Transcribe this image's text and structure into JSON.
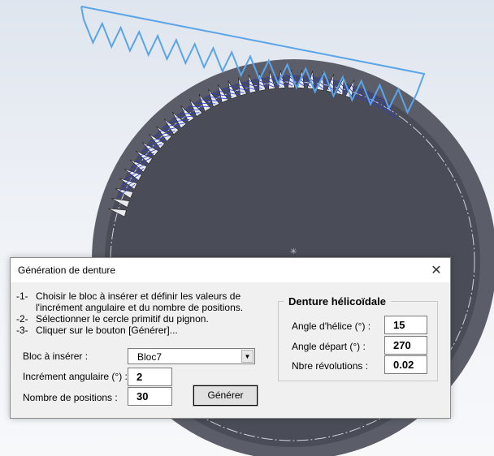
{
  "dialog": {
    "title": "Génération de denture",
    "close_glyph": "✕",
    "instructions": [
      {
        "num": "-1-",
        "text": "Choisir le bloc à insérer et définir les valeurs de"
      },
      {
        "num": "",
        "text": "l'incrément angulaire et du nombre de positions."
      },
      {
        "num": "-2-",
        "text": "Sélectionner le cercle primitif du pignon."
      },
      {
        "num": "-3-",
        "text": "Cliquer sur le bouton [Générer]..."
      }
    ],
    "bloc_label": "Bloc à insérer :",
    "bloc_value": "Bloc7",
    "increment_label": "Incrément angulaire (°) :",
    "increment_value": "2",
    "positions_label": "Nombre de positions :",
    "positions_value": "30",
    "generate_label": "Générer",
    "helical": {
      "title": "Denture hélicoïdale",
      "helix_angle_label": "Angle d'hélice (°) :",
      "helix_angle_value": "15",
      "start_angle_label": "Angle départ (°) :",
      "start_angle_value": "270",
      "revolutions_label": "Nbre révolutions :",
      "revolutions_value": "0.02"
    }
  },
  "colors": {
    "gear_body": "#4a4d57",
    "rack_outline": "#5aa4ea",
    "dialog_bg": "#f0f0f0"
  },
  "icons": {
    "close": "close-icon",
    "dropdown": "chevron-down-icon"
  }
}
